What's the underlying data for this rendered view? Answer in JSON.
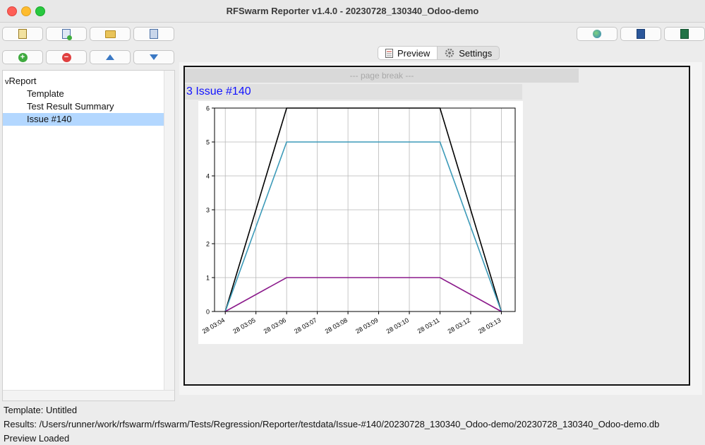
{
  "window": {
    "title": "RFSwarm Reporter v1.4.0 - 20230728_130340_Odoo-demo"
  },
  "icons": {
    "toolbar_left": [
      "new-report-icon",
      "new-file-icon",
      "open-report-icon",
      "save-report-icon"
    ],
    "toolbar_right": [
      "export-html-icon",
      "export-word-icon",
      "export-excel-icon"
    ],
    "section_controls": [
      "add-section-icon",
      "remove-section-icon",
      "move-up-icon",
      "move-down-icon"
    ]
  },
  "tabs": {
    "preview": "Preview",
    "settings": "Settings"
  },
  "tree": {
    "root": {
      "toggle": "v",
      "label": "Report"
    },
    "items": [
      "Template",
      "Test Result Summary",
      "Issue #140"
    ]
  },
  "preview": {
    "page_break": "--- page break ---",
    "section_title": "3 Issue #140"
  },
  "chart_data": {
    "type": "line",
    "x": [
      "28 03:04",
      "28 03:05",
      "28 03:06",
      "28 03:07",
      "28 03:08",
      "28 03:09",
      "28 03:10",
      "28 03:11",
      "28 03:12",
      "28 03:13"
    ],
    "ylim": [
      0,
      6
    ],
    "yticks": [
      "0",
      "1",
      "2",
      "3",
      "4",
      "5",
      "6"
    ],
    "grid": true,
    "series": [
      {
        "color": "#000000",
        "points": [
          [
            0,
            0
          ],
          [
            2,
            6
          ],
          [
            7,
            6
          ],
          [
            9,
            0
          ]
        ]
      },
      {
        "color": "#3c9ab8",
        "points": [
          [
            0,
            0
          ],
          [
            2,
            5
          ],
          [
            7,
            5
          ],
          [
            9,
            0
          ]
        ]
      },
      {
        "color": "#8b1a8b",
        "points": [
          [
            0,
            0
          ],
          [
            2,
            1
          ],
          [
            7,
            1
          ],
          [
            9,
            0
          ]
        ]
      }
    ]
  },
  "status": {
    "template": "Template: Untitled",
    "results": "Results: /Users/runner/work/rfswarm/rfswarm/Tests/Regression/Reporter/testdata/Issue-#140/20230728_130340_Odoo-demo/20230728_130340_Odoo-demo.db",
    "message": "Preview Loaded"
  }
}
